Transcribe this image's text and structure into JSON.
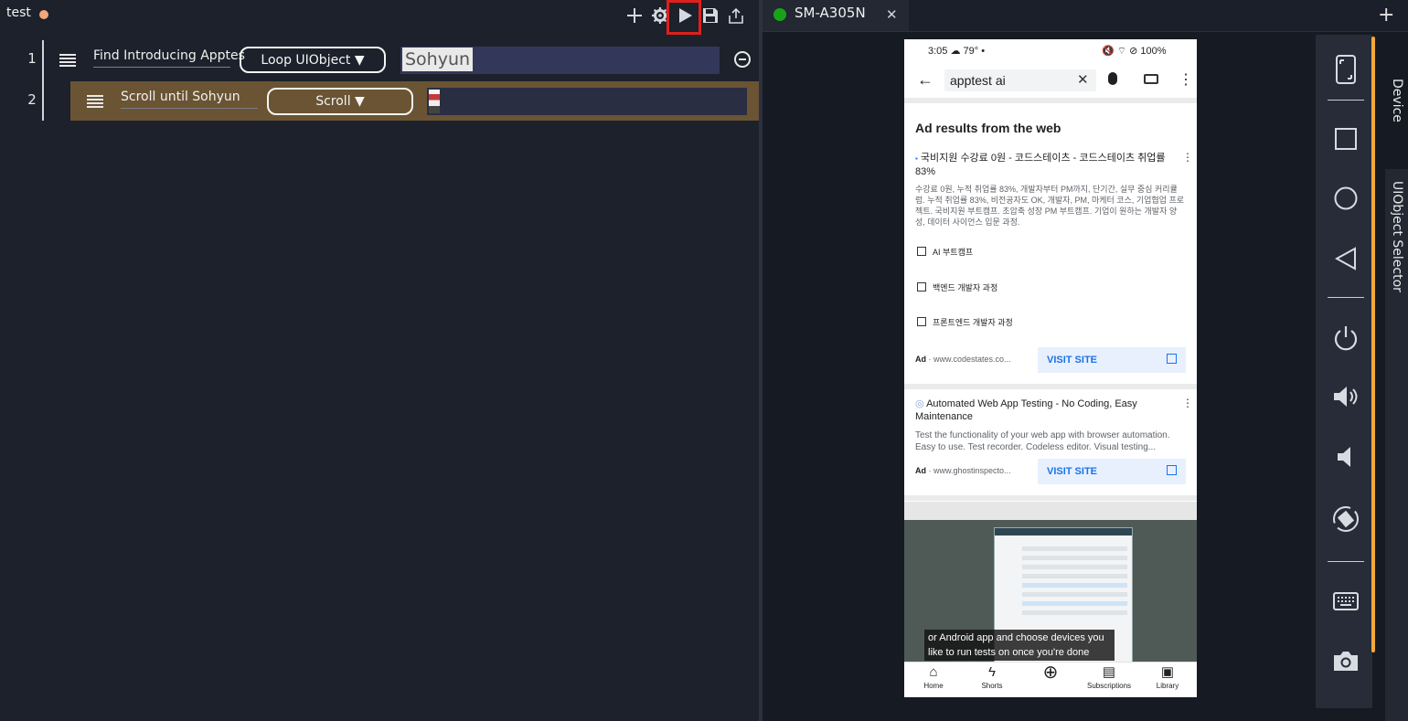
{
  "editor": {
    "title": "test",
    "toolbar": {
      "add_icon": "plus-icon",
      "settings_icon": "gear-icon",
      "run_icon": "play-icon",
      "save_icon": "save-icon",
      "export_icon": "upload-icon"
    },
    "steps": [
      {
        "number": "1",
        "name": "Find Introducing Apptes",
        "action": "Loop UIObject ▼",
        "param": "Sohyun"
      },
      {
        "number": "2",
        "name": "Scroll until Sohyun",
        "action": "Scroll ▼",
        "param": ""
      }
    ]
  },
  "device_panel": {
    "tab_name": "SM-A305N",
    "status_color": "#1aa11a",
    "tools": [
      "screen-icon",
      "square-icon",
      "circle-icon",
      "triangle-back-icon",
      "power-icon",
      "volume-up-icon",
      "volume-down-icon",
      "rotate-icon",
      "keyboard-icon",
      "camera-icon"
    ],
    "side_tabs": [
      "Device",
      "UIObject Selector"
    ]
  },
  "phone": {
    "status_time": "3:05",
    "status_extra": "☁ 79°",
    "status_right": "🔇 ⌔ ⊘ 100%",
    "search_query": "apptest ai",
    "ad_heading": "Ad results from the web",
    "ad1": {
      "title": "국비지원 수강료 0원 - 코드스테이츠 - 코드스테이츠 취업률 83%",
      "desc": "수강료 0원, 누적 취업률 83%, 개발자부터 PM까지, 단기간, 실무 중심 커리큘럼. 누적 취업률 83%, 비전공자도 OK, 개발자, PM, 마케터 코스, 기업협업 프로젝트. 국비지원 부트캠프. 초압축 성장 PM 부트캠프. 기업이 원하는 개발자 양성, 데이터 사이언스 입문 과정.",
      "sitelinks": [
        "AI 부트캠프",
        "백엔드 개발자 과정",
        "프론트엔드 개발자 과정"
      ],
      "ad_label": "Ad",
      "url": "www.codestates.co...",
      "visit": "VISIT SITE"
    },
    "ad2": {
      "title": "Automated Web App Testing - No Coding, Easy Maintenance",
      "desc": "Test the functionality of your web app with browser automation. Easy to use. Test recorder. Codeless editor. Visual testing...",
      "ad_label": "Ad",
      "url": "www.ghostinspecto...",
      "visit": "VISIT SITE"
    },
    "video_caption": "or Android app and choose devices you like to run tests on once you're done",
    "nav": [
      "Home",
      "Shorts",
      "",
      "Subscriptions",
      "Library"
    ]
  }
}
